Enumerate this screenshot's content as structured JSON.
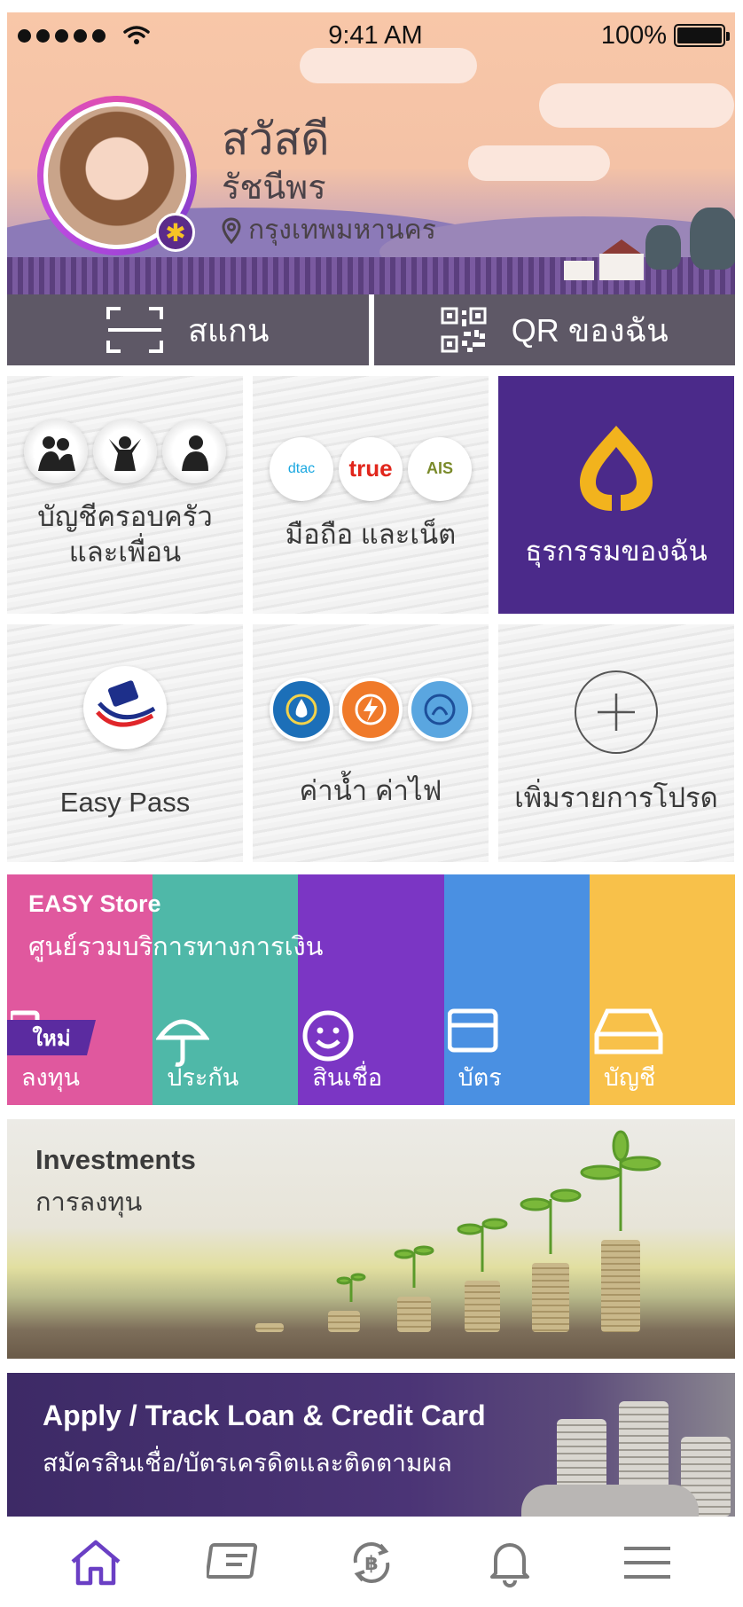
{
  "status_bar": {
    "time": "9:41 AM",
    "battery": "100%"
  },
  "profile": {
    "greeting": "สวัสดี",
    "name": "รัชนีพร",
    "location": "กรุงเทพมหานคร"
  },
  "actions": {
    "scan_label": "สแกน",
    "qr_label": "QR ของฉัน"
  },
  "tiles": [
    {
      "label_line1": "บัญชีครอบครัว",
      "label_line2": "และเพื่อน"
    },
    {
      "label_line1": "มือถือ และเน็ต",
      "logos": [
        "dtac",
        "true",
        "AIS"
      ]
    },
    {
      "label_line1": "ธุรกรรมของฉัน"
    },
    {
      "label_line1": "Easy Pass"
    },
    {
      "label_line1": "ค่าน้ำ ค่าไฟ"
    },
    {
      "label_line1": "เพิ่มรายการโปรด"
    }
  ],
  "easy_store": {
    "title": "EASY Store",
    "subtitle": "ศูนย์รวมบริการทางการเงิน",
    "new_badge": "ใหม่",
    "categories": [
      {
        "label": "ลงทุน",
        "color": "#e0589e",
        "icon": "invest-icon"
      },
      {
        "label": "ประกัน",
        "color": "#4fb8a8",
        "icon": "umbrella-icon"
      },
      {
        "label": "สินเชื่อ",
        "color": "#7b36c4",
        "icon": "smile-icon"
      },
      {
        "label": "บัตร",
        "color": "#4a90e2",
        "icon": "card-icon"
      },
      {
        "label": "บัญชี",
        "color": "#f8c14a",
        "icon": "account-icon"
      }
    ]
  },
  "investments": {
    "title": "Investments",
    "subtitle": "การลงทุน"
  },
  "loan": {
    "title": "Apply / Track Loan & Credit Card",
    "subtitle": "สมัครสินเชื่อ/บัตรเครดิตและติดตามผล"
  },
  "tabbar": {
    "items": [
      "home-icon",
      "card-icon",
      "transfer-icon",
      "bell-icon",
      "menu-icon"
    ],
    "active_color": "#6a3fc4"
  }
}
